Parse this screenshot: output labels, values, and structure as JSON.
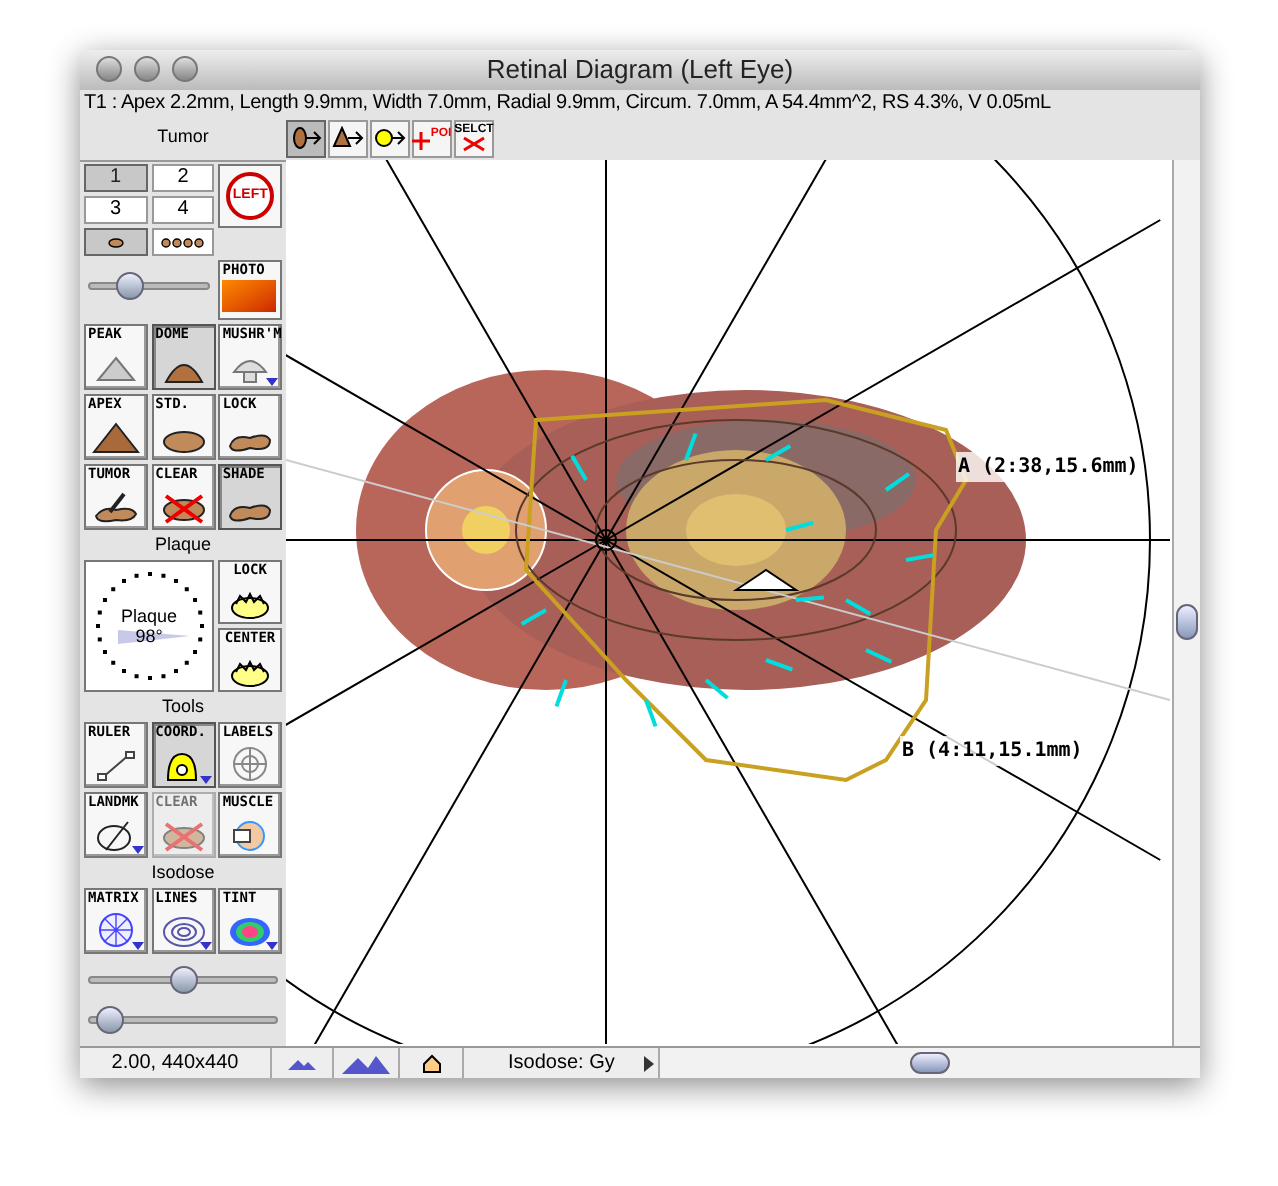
{
  "window": {
    "title": "Retinal Diagram (Left Eye)"
  },
  "info_line": "T1 : Apex 2.2mm, Length 9.9mm, Width 7.0mm, Radial 9.9mm, Circum. 7.0mm, A 54.4mm^2, RS 4.3%, V 0.05mL",
  "toolbar": [
    {
      "kind": "tumor-arrow",
      "selected": true
    },
    {
      "kind": "peak-arrow",
      "selected": false
    },
    {
      "kind": "dot-arrow",
      "selected": false
    },
    {
      "kind": "poi",
      "label": "POI",
      "selected": false
    },
    {
      "kind": "select",
      "label": "SELCT",
      "selected": false
    }
  ],
  "tumor": {
    "heading": "Tumor",
    "numbers": [
      {
        "label": "1",
        "selected": true
      },
      {
        "label": "2",
        "selected": false
      },
      {
        "label": "3",
        "selected": false
      },
      {
        "label": "4",
        "selected": false
      }
    ],
    "shapes": [
      {
        "kind": "single",
        "selected": true
      },
      {
        "kind": "multi",
        "selected": false
      }
    ],
    "side_button": "LEFT",
    "slider": {
      "level": 0.3
    },
    "photo_button": "PHOTO",
    "tools": [
      {
        "label": "PEAK",
        "kind": "peak",
        "selected": false,
        "menu": false
      },
      {
        "label": "DOME",
        "kind": "dome",
        "selected": true,
        "menu": false
      },
      {
        "label": "MUSHR'M",
        "kind": "mushroom",
        "selected": false,
        "menu": true
      },
      {
        "label": "APEX",
        "kind": "apex",
        "selected": false,
        "menu": false
      },
      {
        "label": "STD.",
        "kind": "oval",
        "selected": false,
        "menu": false
      },
      {
        "label": "LOCK",
        "kind": "blob",
        "selected": false,
        "menu": false
      },
      {
        "label": "TUMOR",
        "kind": "draw",
        "selected": false,
        "menu": false
      },
      {
        "label": "CLEAR",
        "kind": "clear",
        "selected": false,
        "menu": false
      },
      {
        "label": "SHADE",
        "kind": "blob",
        "selected": true,
        "menu": false
      }
    ]
  },
  "plaque": {
    "heading": "Plaque",
    "dial_label": "Plaque",
    "dial_angle": "98°",
    "buttons": [
      {
        "label": "LOCK"
      },
      {
        "label": "CENTER"
      }
    ]
  },
  "tools": {
    "heading": "Tools",
    "items": [
      {
        "label": "RULER",
        "kind": "ruler",
        "selected": false,
        "disabled": false,
        "menu": false
      },
      {
        "label": "COORD.",
        "kind": "coord",
        "selected": true,
        "disabled": false,
        "menu": true
      },
      {
        "label": "LABELS",
        "kind": "labels",
        "selected": false,
        "disabled": false,
        "menu": false
      },
      {
        "label": "LANDMK",
        "kind": "landmark",
        "selected": false,
        "disabled": false,
        "menu": true
      },
      {
        "label": "CLEAR",
        "kind": "clear",
        "selected": false,
        "disabled": true,
        "menu": false
      },
      {
        "label": "MUSCLE",
        "kind": "muscle",
        "selected": false,
        "disabled": false,
        "menu": false
      }
    ]
  },
  "isodose": {
    "heading": "Isodose",
    "items": [
      {
        "label": "MATRIX",
        "kind": "matrix",
        "menu": true
      },
      {
        "label": "LINES",
        "kind": "lines",
        "menu": true
      },
      {
        "label": "TINT",
        "kind": "tint",
        "menu": true
      }
    ],
    "sliders": [
      {
        "level": 0.5
      },
      {
        "level": 0.05
      }
    ]
  },
  "canvas": {
    "labels": [
      {
        "text": "A (2:38,15.6mm)"
      },
      {
        "text": "B (4:11,15.1mm)"
      }
    ]
  },
  "status_bar": {
    "zoom": "2.00, 440x440",
    "isodose": "Isodose: Gy"
  }
}
